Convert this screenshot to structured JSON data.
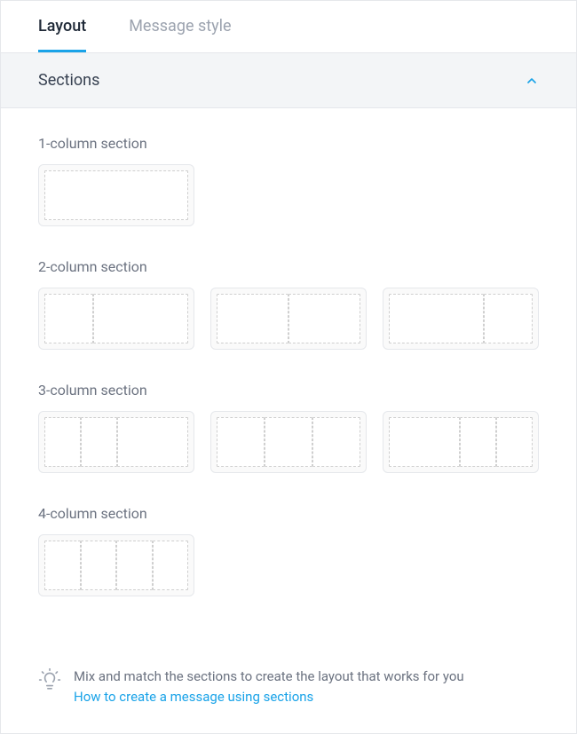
{
  "tabs": {
    "layout": "Layout",
    "message_style": "Message style"
  },
  "panel": {
    "title": "Sections"
  },
  "sections": {
    "one_col_label": "1-column section",
    "two_col_label": "2-column section",
    "three_col_label": "3-column section",
    "four_col_label": "4-column section"
  },
  "tip": {
    "text": "Mix and match the sections to create the layout that works for you",
    "link": "How to create a message using sections"
  }
}
